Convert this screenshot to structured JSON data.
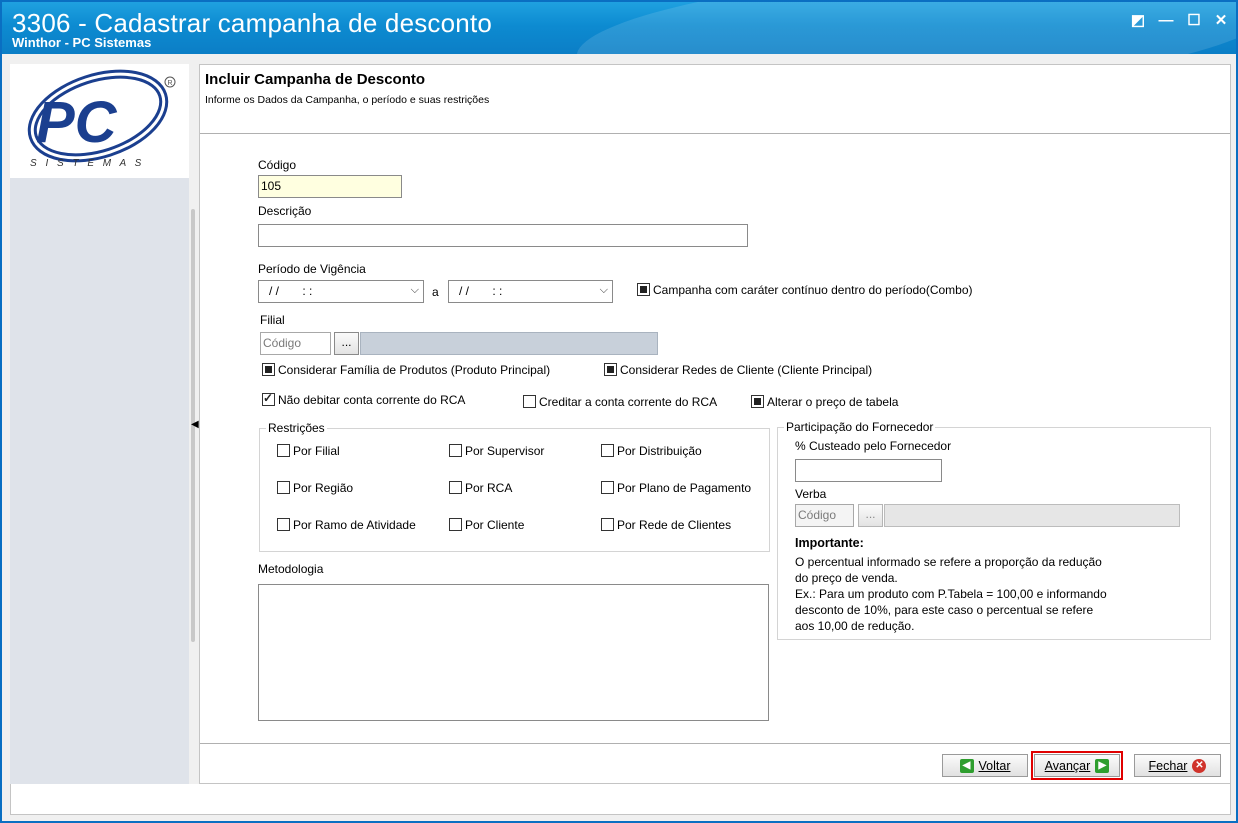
{
  "window": {
    "title": "3306 - Cadastrar campanha de desconto",
    "subtitle": "Winthor - PC Sistemas",
    "controls": [
      "◩",
      "—",
      "☐",
      "✕"
    ]
  },
  "logo": {
    "brand": "PC",
    "tagline": "S I S T E M A S"
  },
  "header": {
    "title": "Incluir Campanha de Desconto",
    "subtitle": "Informe os Dados da Campanha, o período e suas restrições"
  },
  "form": {
    "codigo_label": "Código",
    "codigo_value": "105",
    "descricao_label": "Descrição",
    "descricao_value": "",
    "periodo_label": "Período de Vigência",
    "periodo_start": "/ /       : :",
    "periodo_sep": "a",
    "periodo_end": "/ /       : :",
    "combo_checkbox": "Campanha com caráter contínuo dentro do período(Combo)",
    "filial_label": "Filial",
    "filial_placeholder": "Código",
    "dots": "...",
    "familia_checkbox": "Considerar Família de Produtos (Produto Principal)",
    "redes_checkbox": "Considerar Redes de Cliente (Cliente Principal)",
    "nao_debitar_checkbox": "Não debitar conta corrente do RCA",
    "creditar_checkbox": "Creditar a conta corrente do RCA",
    "alterar_preco_checkbox": "Alterar o preço de tabela",
    "metodologia_label": "Metodologia"
  },
  "restricoes": {
    "title": "Restrições",
    "items": [
      "Por Filial",
      "Por Supervisor",
      "Por Distribuição",
      "Por Região",
      "Por RCA",
      "Por Plano de Pagamento",
      "Por Ramo de Atividade",
      "Por Cliente",
      "Por Rede de Clientes"
    ]
  },
  "fornecedor": {
    "title": "Participação do Fornecedor",
    "custeado_label": "% Custeado pelo Fornecedor",
    "verba_label": "Verba",
    "verba_placeholder": "Código",
    "dots": "...",
    "importante_title": "Importante:",
    "importante_lines": [
      "O percentual informado se refere a proporção da redução",
      "do preço de venda.",
      "Ex.: Para um produto com P.Tabela = 100,00 e informando",
      "desconto de 10%, para este caso o percentual se refere",
      "aos 10,00 de redução."
    ]
  },
  "footer": {
    "voltar": "Voltar",
    "avancar": "Avançar",
    "fechar": "Fechar"
  },
  "colors": {
    "titlebar": "#0d8bd1",
    "highlight": "#e00000",
    "green_icon": "#2e9e2e",
    "red_icon": "#d0332b"
  }
}
